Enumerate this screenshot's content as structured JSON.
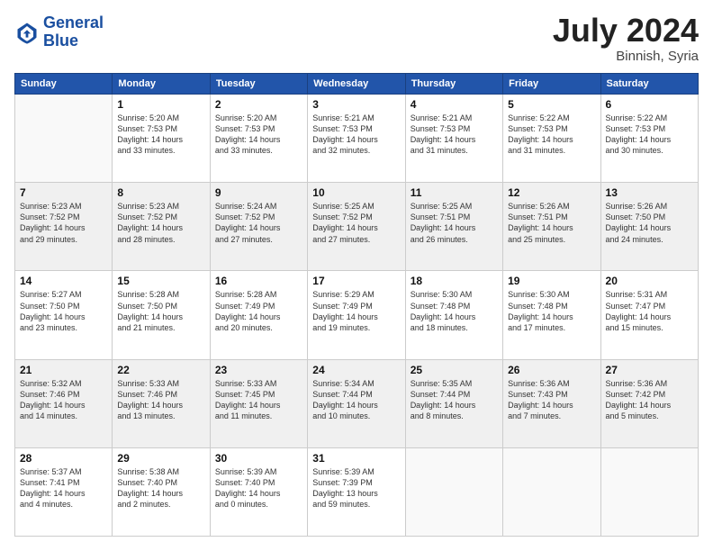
{
  "logo": {
    "line1": "General",
    "line2": "Blue"
  },
  "title": "July 2024",
  "location": "Binnish, Syria",
  "days_of_week": [
    "Sunday",
    "Monday",
    "Tuesday",
    "Wednesday",
    "Thursday",
    "Friday",
    "Saturday"
  ],
  "weeks": [
    [
      {
        "day": "",
        "info": ""
      },
      {
        "day": "1",
        "info": "Sunrise: 5:20 AM\nSunset: 7:53 PM\nDaylight: 14 hours\nand 33 minutes."
      },
      {
        "day": "2",
        "info": "Sunrise: 5:20 AM\nSunset: 7:53 PM\nDaylight: 14 hours\nand 33 minutes."
      },
      {
        "day": "3",
        "info": "Sunrise: 5:21 AM\nSunset: 7:53 PM\nDaylight: 14 hours\nand 32 minutes."
      },
      {
        "day": "4",
        "info": "Sunrise: 5:21 AM\nSunset: 7:53 PM\nDaylight: 14 hours\nand 31 minutes."
      },
      {
        "day": "5",
        "info": "Sunrise: 5:22 AM\nSunset: 7:53 PM\nDaylight: 14 hours\nand 31 minutes."
      },
      {
        "day": "6",
        "info": "Sunrise: 5:22 AM\nSunset: 7:53 PM\nDaylight: 14 hours\nand 30 minutes."
      }
    ],
    [
      {
        "day": "7",
        "info": "Sunrise: 5:23 AM\nSunset: 7:52 PM\nDaylight: 14 hours\nand 29 minutes."
      },
      {
        "day": "8",
        "info": "Sunrise: 5:23 AM\nSunset: 7:52 PM\nDaylight: 14 hours\nand 28 minutes."
      },
      {
        "day": "9",
        "info": "Sunrise: 5:24 AM\nSunset: 7:52 PM\nDaylight: 14 hours\nand 27 minutes."
      },
      {
        "day": "10",
        "info": "Sunrise: 5:25 AM\nSunset: 7:52 PM\nDaylight: 14 hours\nand 27 minutes."
      },
      {
        "day": "11",
        "info": "Sunrise: 5:25 AM\nSunset: 7:51 PM\nDaylight: 14 hours\nand 26 minutes."
      },
      {
        "day": "12",
        "info": "Sunrise: 5:26 AM\nSunset: 7:51 PM\nDaylight: 14 hours\nand 25 minutes."
      },
      {
        "day": "13",
        "info": "Sunrise: 5:26 AM\nSunset: 7:50 PM\nDaylight: 14 hours\nand 24 minutes."
      }
    ],
    [
      {
        "day": "14",
        "info": "Sunrise: 5:27 AM\nSunset: 7:50 PM\nDaylight: 14 hours\nand 23 minutes."
      },
      {
        "day": "15",
        "info": "Sunrise: 5:28 AM\nSunset: 7:50 PM\nDaylight: 14 hours\nand 21 minutes."
      },
      {
        "day": "16",
        "info": "Sunrise: 5:28 AM\nSunset: 7:49 PM\nDaylight: 14 hours\nand 20 minutes."
      },
      {
        "day": "17",
        "info": "Sunrise: 5:29 AM\nSunset: 7:49 PM\nDaylight: 14 hours\nand 19 minutes."
      },
      {
        "day": "18",
        "info": "Sunrise: 5:30 AM\nSunset: 7:48 PM\nDaylight: 14 hours\nand 18 minutes."
      },
      {
        "day": "19",
        "info": "Sunrise: 5:30 AM\nSunset: 7:48 PM\nDaylight: 14 hours\nand 17 minutes."
      },
      {
        "day": "20",
        "info": "Sunrise: 5:31 AM\nSunset: 7:47 PM\nDaylight: 14 hours\nand 15 minutes."
      }
    ],
    [
      {
        "day": "21",
        "info": "Sunrise: 5:32 AM\nSunset: 7:46 PM\nDaylight: 14 hours\nand 14 minutes."
      },
      {
        "day": "22",
        "info": "Sunrise: 5:33 AM\nSunset: 7:46 PM\nDaylight: 14 hours\nand 13 minutes."
      },
      {
        "day": "23",
        "info": "Sunrise: 5:33 AM\nSunset: 7:45 PM\nDaylight: 14 hours\nand 11 minutes."
      },
      {
        "day": "24",
        "info": "Sunrise: 5:34 AM\nSunset: 7:44 PM\nDaylight: 14 hours\nand 10 minutes."
      },
      {
        "day": "25",
        "info": "Sunrise: 5:35 AM\nSunset: 7:44 PM\nDaylight: 14 hours\nand 8 minutes."
      },
      {
        "day": "26",
        "info": "Sunrise: 5:36 AM\nSunset: 7:43 PM\nDaylight: 14 hours\nand 7 minutes."
      },
      {
        "day": "27",
        "info": "Sunrise: 5:36 AM\nSunset: 7:42 PM\nDaylight: 14 hours\nand 5 minutes."
      }
    ],
    [
      {
        "day": "28",
        "info": "Sunrise: 5:37 AM\nSunset: 7:41 PM\nDaylight: 14 hours\nand 4 minutes."
      },
      {
        "day": "29",
        "info": "Sunrise: 5:38 AM\nSunset: 7:40 PM\nDaylight: 14 hours\nand 2 minutes."
      },
      {
        "day": "30",
        "info": "Sunrise: 5:39 AM\nSunset: 7:40 PM\nDaylight: 14 hours\nand 0 minutes."
      },
      {
        "day": "31",
        "info": "Sunrise: 5:39 AM\nSunset: 7:39 PM\nDaylight: 13 hours\nand 59 minutes."
      },
      {
        "day": "",
        "info": ""
      },
      {
        "day": "",
        "info": ""
      },
      {
        "day": "",
        "info": ""
      }
    ]
  ]
}
